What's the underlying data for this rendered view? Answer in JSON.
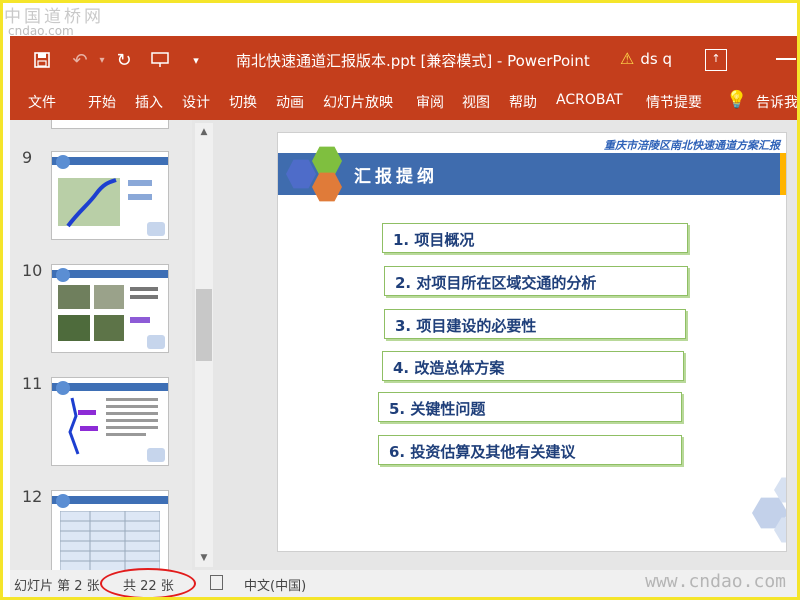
{
  "watermarks": {
    "top": "中国道桥网",
    "top_sub": "cndao.com",
    "bottom": "www.cndao.com"
  },
  "titlebar": {
    "title": "南北快速通道汇报版本.ppt [兼容模式] - PowerPoint",
    "user": "ds q"
  },
  "ribbon": {
    "tabs": [
      "文件",
      "开始",
      "插入",
      "设计",
      "切换",
      "动画",
      "幻灯片放映",
      "审阅",
      "视图",
      "帮助",
      "ACROBAT",
      "情节提要"
    ],
    "tell_me": "告诉我"
  },
  "thumbnails": [
    {
      "number": "9"
    },
    {
      "number": "10"
    },
    {
      "number": "11"
    },
    {
      "number": "12"
    }
  ],
  "slide": {
    "subtitle": "重庆市涪陵区南北快速通道方案汇报",
    "heading": "汇报提纲",
    "items": [
      "1. 项目概况",
      "2. 对项目所在区域交通的分析",
      "3. 项目建设的必要性",
      "4. 改造总体方案",
      "5. 关键性问题",
      "6. 投资估算及其他有关建议"
    ],
    "colors": {
      "band": "#3f6cae",
      "hex_blue": "#4e6cc9",
      "hex_green": "#7fbf3f",
      "hex_orange": "#e07b39",
      "item_border": "#8fbf64"
    }
  },
  "statusbar": {
    "slide": "幻灯片 第 2 张",
    "total": "共 22 张",
    "language": "中文(中国)"
  },
  "theme": {
    "accent": "#c43e1c",
    "highlight": "#e21c1c",
    "frame": "#f5e52a"
  }
}
